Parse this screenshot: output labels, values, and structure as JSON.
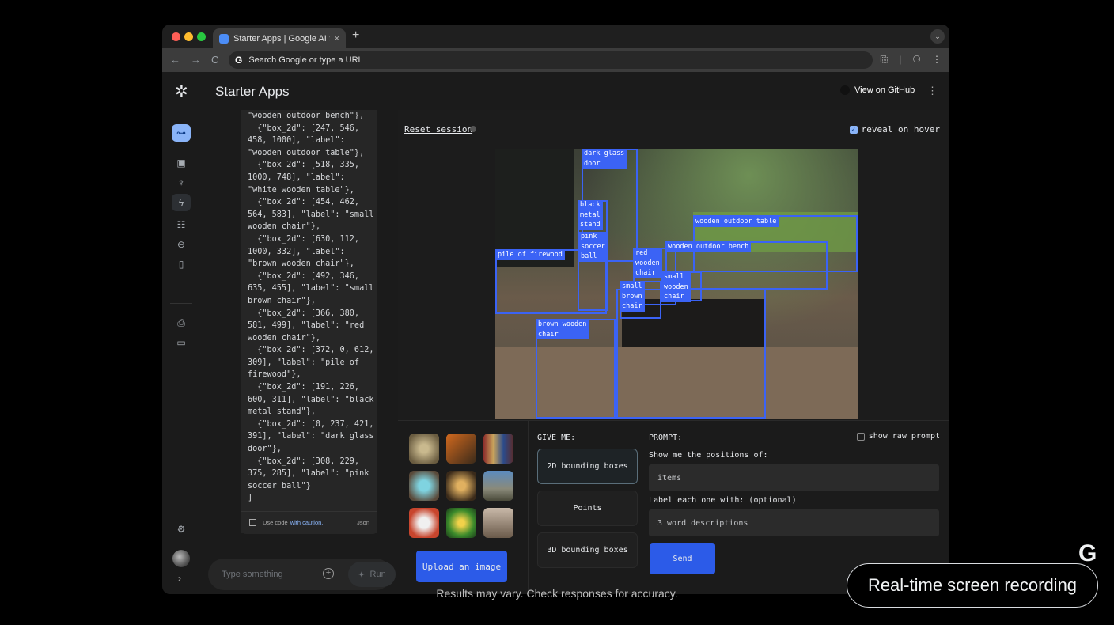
{
  "browser": {
    "tab_title": "Starter Apps | Google AI Stud",
    "tab_close": "×",
    "new_tab": "+",
    "menu": "⌄",
    "back": "←",
    "forward": "→",
    "reload": "C",
    "url_g": "G",
    "url_placeholder": "Search Google or type a URL",
    "url_icons": [
      "⎘",
      "|",
      "⚇",
      "⋮"
    ]
  },
  "header": {
    "logo": "✲",
    "title": "Starter Apps",
    "github": "View on GitHub",
    "more": "⋮"
  },
  "sidebar_icons": [
    {
      "name": "key-icon",
      "glyph": "⊶"
    },
    {
      "name": "image-icon",
      "glyph": "▣"
    },
    {
      "name": "microphone-icon",
      "glyph": "♆"
    },
    {
      "name": "bolt-icon",
      "glyph": "ϟ"
    },
    {
      "name": "tune-icon",
      "glyph": "☷"
    },
    {
      "name": "archive-icon",
      "glyph": "⊖"
    },
    {
      "name": "book-icon",
      "glyph": "▯"
    },
    {
      "name": "document-search-icon",
      "glyph": "⎙"
    },
    {
      "name": "chat-icon",
      "glyph": "▭"
    },
    {
      "name": "settings-icon",
      "glyph": "⚙"
    }
  ],
  "code": {
    "lines": [
      "\"wooden outdoor bench\"},",
      "  {\"box_2d\": [247, 546,",
      "458, 1000], \"label\":",
      "\"wooden outdoor table\"},",
      "  {\"box_2d\": [518, 335,",
      "1000, 748], \"label\":",
      "\"white wooden table\"},",
      "  {\"box_2d\": [454, 462,",
      "564, 583], \"label\": \"small",
      "wooden chair\"},",
      "  {\"box_2d\": [630, 112,",
      "1000, 332], \"label\":",
      "\"brown wooden chair\"},",
      "  {\"box_2d\": [492, 346,",
      "635, 455], \"label\": \"small",
      "brown chair\"},",
      "  {\"box_2d\": [366, 380,",
      "581, 499], \"label\": \"red",
      "wooden chair\"},",
      "  {\"box_2d\": [372, 0, 612,",
      "309], \"label\": \"pile of",
      "firewood\"},",
      "  {\"box_2d\": [191, 226,",
      "600, 311], \"label\": \"black",
      "metal stand\"},",
      "  {\"box_2d\": [0, 237, 421,",
      "391], \"label\": \"dark glass",
      "door\"},",
      "  {\"box_2d\": [308, 229,",
      "375, 285], \"label\": \"pink",
      "soccer ball\"}",
      "]"
    ],
    "footer_use": "Use code",
    "footer_caution": "with caution.",
    "footer_lang": "Json"
  },
  "chat": {
    "placeholder": "Type something",
    "plus": "+",
    "run": "Run",
    "run_icon": "✦",
    "collapse": "›"
  },
  "main": {
    "reset": "Reset session",
    "reveal": "reveal on hover",
    "check": "✓"
  },
  "boxes": [
    {
      "label": "dark glass\ndoor"
    },
    {
      "label": "black\nmetal\nstand"
    },
    {
      "label": "pink\nsoccer\nball"
    },
    {
      "label": "wooden outdoor table"
    },
    {
      "label": "wooden outdoor bench"
    },
    {
      "label": "pile of firewood"
    },
    {
      "label": "red\nwooden\nchair"
    },
    {
      "label": "small\nwooden\nchair"
    },
    {
      "label": "small\nbrown\nchair"
    },
    {
      "label": "brown wooden\nchair"
    },
    {
      "label": ""
    }
  ],
  "controls": {
    "upload": "Upload an image",
    "give_me": "GIVE ME:",
    "modes": [
      "2D bounding boxes",
      "Points",
      "3D bounding boxes"
    ],
    "prompt_label": "PROMPT:",
    "show_raw": "show raw prompt",
    "positions_label": "Show me the positions of:",
    "positions_value": "items",
    "label_each": "Label each one with: (optional)",
    "label_value": "3 word descriptions",
    "send": "Send"
  },
  "caption": "Results may vary. Check responses for accuracy.",
  "recording": "Real-time screen recording",
  "g_logo": "G"
}
